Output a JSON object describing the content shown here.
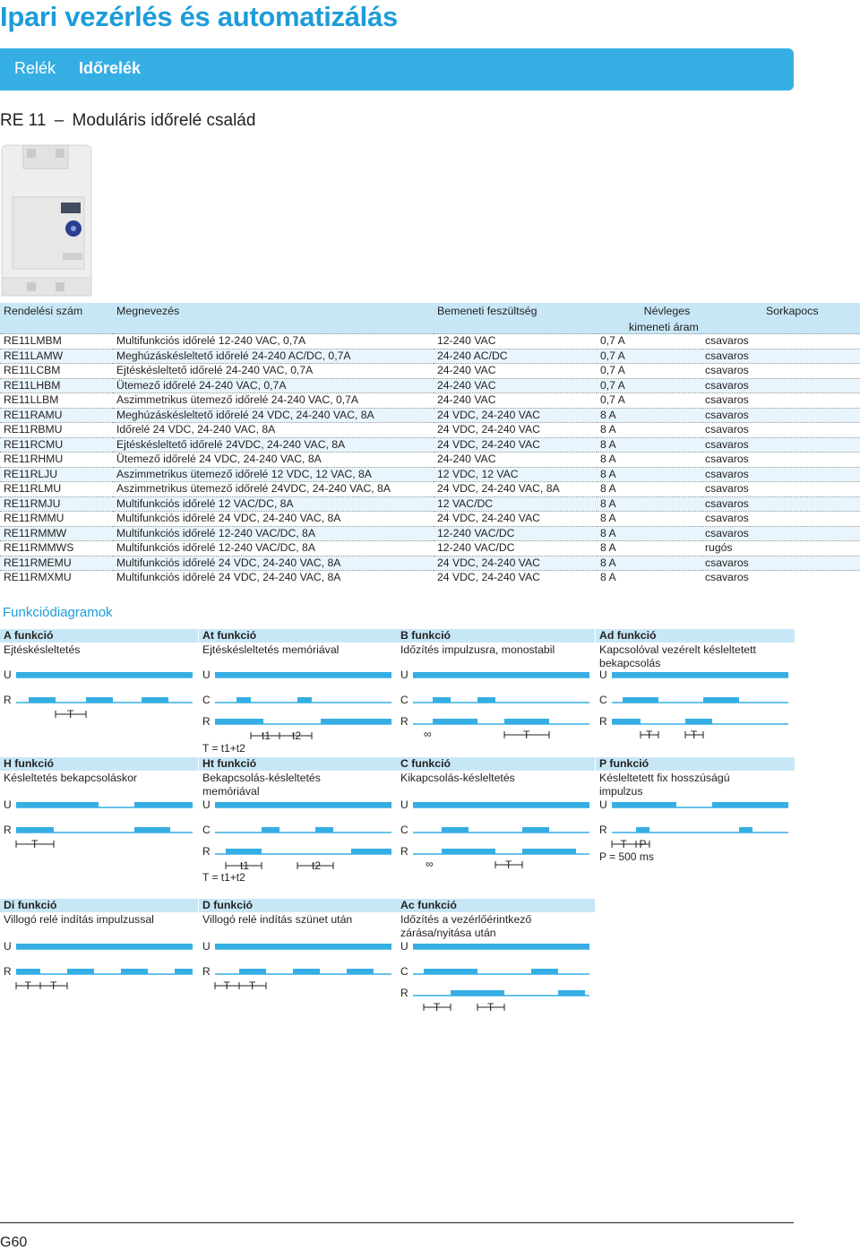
{
  "title": "Ipari vezérlés és automatizálás",
  "breadcrumb": {
    "level1": "Relék",
    "level2": "Időrelék"
  },
  "subtitle": {
    "series": "RE 11",
    "dash": "–",
    "text": "Moduláris időrelé család"
  },
  "table": {
    "headers": {
      "code": "Rendelési szám",
      "name": "Megnevezés",
      "voltage": "Bemeneti feszültség",
      "current_1": "Névleges",
      "current_2": "kimeneti áram",
      "terminal": "Sorkapocs"
    },
    "rows": [
      [
        "RE11LMBM",
        "Multifunkciós időrelé 12-240 VAC, 0,7A",
        "12-240 VAC",
        "0,7 A",
        "csavaros"
      ],
      [
        "RE11LAMW",
        "Meghúzáskésleltető időrelé 24-240 AC/DC, 0,7A",
        "24-240 AC/DC",
        "0,7 A",
        "csavaros"
      ],
      [
        "RE11LCBM",
        "Ejtéskésleltető időrelé 24-240 VAC, 0,7A",
        "24-240 VAC",
        "0,7 A",
        "csavaros"
      ],
      [
        "RE11LHBM",
        "Ütemező időrelé 24-240 VAC, 0,7A",
        "24-240 VAC",
        "0,7 A",
        "csavaros"
      ],
      [
        "RE11LLBM",
        "Aszimmetrikus ütemező időrelé 24-240 VAC, 0,7A",
        "24-240 VAC",
        "0,7 A",
        "csavaros"
      ],
      [
        "RE11RAMU",
        "Meghúzáskésleltető időrelé 24 VDC, 24-240 VAC, 8A",
        "24 VDC, 24-240 VAC",
        "8 A",
        "csavaros"
      ],
      [
        "RE11RBMU",
        "Időrelé 24 VDC, 24-240 VAC, 8A",
        "24 VDC, 24-240 VAC",
        "8 A",
        "csavaros"
      ],
      [
        "RE11RCMU",
        "Ejtéskésleltető időrelé 24VDC, 24-240 VAC, 8A",
        "24 VDC, 24-240 VAC",
        "8 A",
        "csavaros"
      ],
      [
        "RE11RHMU",
        "Ütemező időrelé 24 VDC, 24-240 VAC, 8A",
        "24-240 VAC",
        "8 A",
        "csavaros"
      ],
      [
        "RE11RLJU",
        "Aszimmetrikus ütemező időrelé 12 VDC, 12 VAC, 8A",
        "12 VDC, 12 VAC",
        "8 A",
        "csavaros"
      ],
      [
        "RE11RLMU",
        "Aszimmetrikus ütemező időrelé 24VDC, 24-240 VAC, 8A",
        "24 VDC, 24-240 VAC, 8A",
        "8 A",
        "csavaros"
      ],
      [
        "RE11RMJU",
        "Multifunkciós időrelé 12 VAC/DC, 8A",
        "12 VAC/DC",
        "8 A",
        "csavaros"
      ],
      [
        "RE11RMMU",
        "Multifunkciós időrelé 24 VDC, 24-240 VAC, 8A",
        "24 VDC, 24-240 VAC",
        "8 A",
        "csavaros"
      ],
      [
        "RE11RMMW",
        "Multifunkciós időrelé 12-240 VAC/DC, 8A",
        "12-240 VAC/DC",
        "8 A",
        "csavaros"
      ],
      [
        "RE11RMMWS",
        "Multifunkciós időrelé 12-240 VAC/DC, 8A",
        "12-240 VAC/DC",
        "8 A",
        "rugós"
      ],
      [
        "RE11RMEMU",
        "Multifunkciós időrelé 24 VDC, 24-240 VAC, 8A",
        "24 VDC, 24-240 VAC",
        "8 A",
        "csavaros"
      ],
      [
        "RE11RMXMU",
        "Multifunkciós időrelé 24 VDC, 24-240 VAC, 8A",
        "24 VDC, 24-240 VAC",
        "8 A",
        "csavaros"
      ]
    ]
  },
  "functions_title": "Funkciódiagramok",
  "functions": {
    "A": {
      "name": "A funkció",
      "desc": "Ejtéskésleltetés"
    },
    "At": {
      "name": "At funkció",
      "desc": "Ejtéskésleltetés memóriával",
      "note": "T = t1+t2"
    },
    "B": {
      "name": "B funkció",
      "desc": "Időzítés impulzusra, monostabil"
    },
    "Ad": {
      "name": "Ad funkció",
      "desc": "Kapcsolóval vezérelt késleltetett bekapcsolás"
    },
    "H": {
      "name": "H funkció",
      "desc": "Késleltetés bekapcsoláskor"
    },
    "Ht": {
      "name": "Ht funkció",
      "desc": "Bekapcsolás-késleltetés memóriával",
      "note": "T = t1+t2"
    },
    "C": {
      "name": "C funkció",
      "desc": "Kikapcsolás-késleltetés"
    },
    "P": {
      "name": "P funkció",
      "desc": "Késleltetett fix hosszúságú impulzus",
      "note": "P = 500 ms"
    },
    "Di": {
      "name": "Di funkció",
      "desc": "Villogó relé indítás impulzussal"
    },
    "D": {
      "name": "D funkció",
      "desc": "Villogó relé indítás szünet után"
    },
    "Ac": {
      "name": "Ac funkció",
      "desc": "Időzítés a vezérlőérintkező zárása/nyitása után"
    }
  },
  "signal_labels": {
    "U": "U",
    "R": "R",
    "C": "C",
    "T": "T",
    "P": "P",
    "t1": "t1",
    "t2": "t2",
    "infinity": "∞"
  },
  "page_number": "G60",
  "colors": {
    "accent": "#1d9cd8",
    "banner": "#35aee4",
    "header_fill": "#c7e7f6",
    "row_alt": "#e8f5fc",
    "signal": "#35aee4"
  }
}
